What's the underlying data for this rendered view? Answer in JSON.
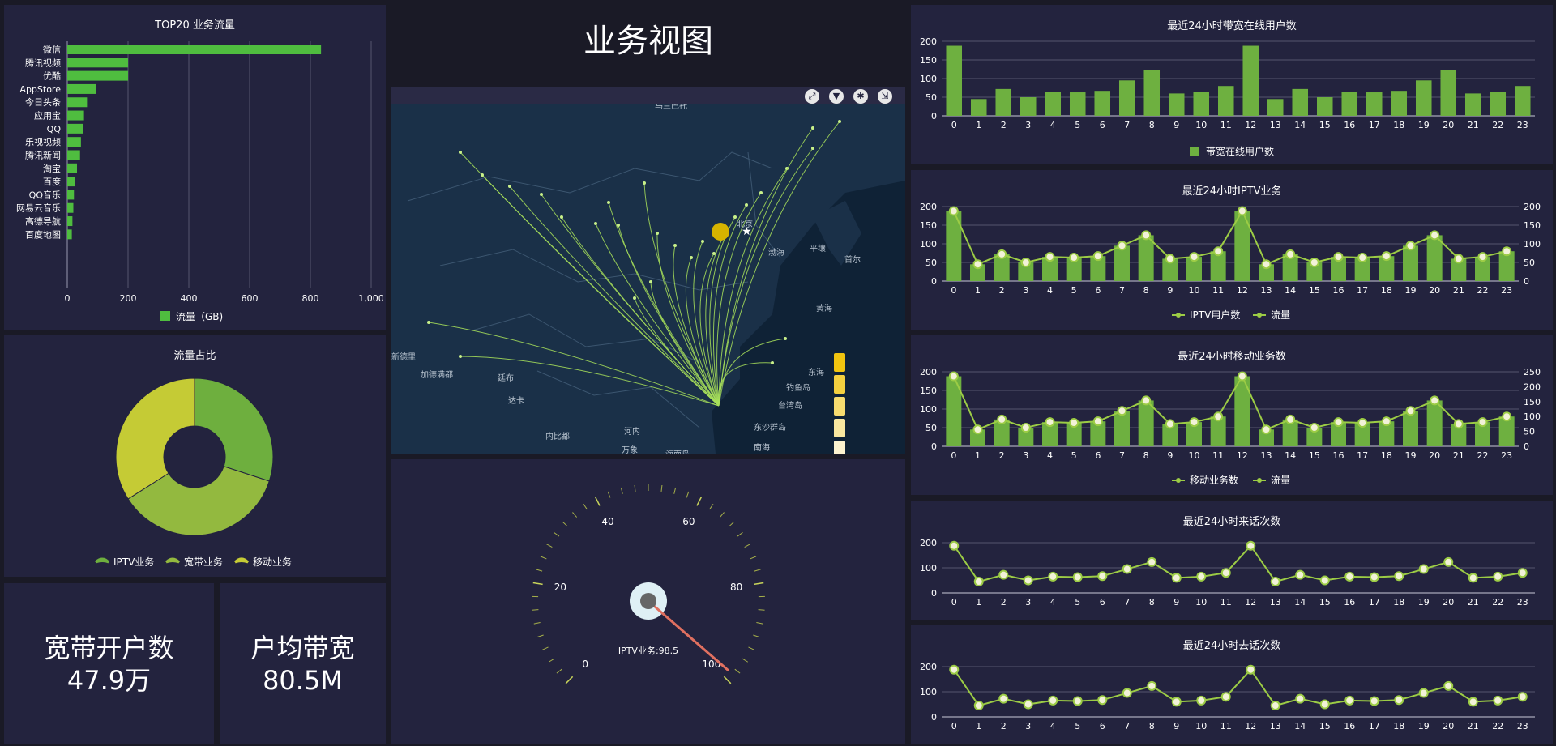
{
  "header": {
    "title": "业务视图"
  },
  "top20": {
    "title": "TOP20 业务流量",
    "legend": "流量（GB)",
    "color": "#4fbd3f",
    "categories": [
      "微信",
      "腾讯视频",
      "优酷",
      "AppStore",
      "今日头条",
      "应用宝",
      "QQ",
      "乐视视频",
      "腾讯新闻",
      "淘宝",
      "百度",
      "QQ音乐",
      "网易云音乐",
      "高德导航",
      "百度地图"
    ],
    "values": [
      835,
      200,
      200,
      95,
      65,
      55,
      52,
      45,
      42,
      32,
      25,
      22,
      20,
      17,
      15
    ],
    "xticks": [
      "0",
      "200",
      "400",
      "600",
      "800",
      "1,000"
    ]
  },
  "ratio": {
    "title": "流量占比",
    "legend": [
      "IPTV业务",
      "宽带业务",
      "移动业务"
    ],
    "values": [
      30,
      36,
      34
    ],
    "colors": [
      "#6eaf3e",
      "#93b93f",
      "#c5cb35"
    ]
  },
  "stats": [
    {
      "label": "宽带开户数",
      "value": "47.9万"
    },
    {
      "label": "户均带宽",
      "value": "80.5M"
    }
  ],
  "map": {
    "labels": [
      "乌兰巴托",
      "北京",
      "渤海",
      "平壤",
      "首尔",
      "黄海",
      "东海",
      "钓鱼岛",
      "台湾岛",
      "东沙群岛",
      "南海",
      "海南岛",
      "河内",
      "内比都",
      "万象",
      "达卡",
      "加德满都",
      "新德里",
      "廷布"
    ],
    "tools": [
      "fullscreen-icon",
      "filter-icon",
      "settings-icon",
      "export-icon"
    ]
  },
  "gauge": {
    "label": "IPTV业务:98.5",
    "value": 98.5,
    "ticks": [
      "0",
      "20",
      "40",
      "60",
      "80",
      "100"
    ]
  },
  "hours": [
    "0",
    "1",
    "2",
    "3",
    "4",
    "5",
    "6",
    "7",
    "8",
    "9",
    "10",
    "11",
    "12",
    "13",
    "14",
    "15",
    "16",
    "17",
    "18",
    "19",
    "20",
    "21",
    "22",
    "23"
  ],
  "series24": [
    188,
    45,
    72,
    50,
    65,
    63,
    67,
    95,
    123,
    60,
    65,
    80,
    188,
    45,
    72,
    50,
    65,
    63,
    67,
    95,
    123,
    60,
    65,
    80
  ],
  "charts": {
    "c1": {
      "title": "最近24小时带宽在线用户数",
      "legend": "带宽在线用户数",
      "yticks": [
        "0",
        "50",
        "100",
        "150",
        "200"
      ]
    },
    "c2": {
      "title": "最近24小时IPTV业务",
      "legend_bar": "IPTV用户数",
      "legend_line": "流量",
      "yticks": [
        "0",
        "50",
        "100",
        "150",
        "200"
      ],
      "y2ticks": [
        "0",
        "50",
        "100",
        "150",
        "200"
      ]
    },
    "c3": {
      "title": "最近24小时移动业务数",
      "legend_bar": "移动业务数",
      "legend_line": "流量",
      "yticks": [
        "0",
        "50",
        "100",
        "150",
        "200"
      ],
      "y2ticks": [
        "0",
        "50",
        "100",
        "150",
        "200",
        "250"
      ]
    },
    "c4": {
      "title": "最近24小时来话次数",
      "yticks": [
        "0",
        "100",
        "200"
      ]
    },
    "c5": {
      "title": "最近24小时去话次数",
      "yticks": [
        "0",
        "100",
        "200"
      ]
    }
  },
  "chart_data": [
    {
      "type": "bar",
      "title": "TOP20 业务流量",
      "categories": [
        "微信",
        "腾讯视频",
        "优酷",
        "AppStore",
        "今日头条",
        "应用宝",
        "QQ",
        "乐视视频",
        "腾讯新闻",
        "淘宝",
        "百度",
        "QQ音乐",
        "网易云音乐",
        "高德导航",
        "百度地图"
      ],
      "values": [
        835,
        200,
        200,
        95,
        65,
        55,
        52,
        45,
        42,
        32,
        25,
        22,
        20,
        17,
        15
      ],
      "xlim": [
        0,
        1000
      ]
    },
    {
      "type": "pie",
      "title": "流量占比",
      "categories": [
        "IPTV业务",
        "宽带业务",
        "移动业务"
      ],
      "values": [
        30,
        36,
        34
      ]
    },
    {
      "type": "bar",
      "title": "最近24小时带宽在线用户数",
      "categories": [
        "0",
        "1",
        "2",
        "3",
        "4",
        "5",
        "6",
        "7",
        "8",
        "9",
        "10",
        "11",
        "12",
        "13",
        "14",
        "15",
        "16",
        "17",
        "18",
        "19",
        "20",
        "21",
        "22",
        "23"
      ],
      "values": [
        188,
        45,
        72,
        50,
        65,
        63,
        67,
        95,
        123,
        60,
        65,
        80,
        188,
        45,
        72,
        50,
        65,
        63,
        67,
        95,
        123,
        60,
        65,
        80
      ],
      "ylim": [
        0,
        200
      ]
    },
    {
      "type": "bar",
      "title": "最近24小时IPTV业务",
      "series": [
        {
          "name": "IPTV用户数",
          "values": [
            188,
            45,
            72,
            50,
            65,
            63,
            67,
            95,
            123,
            60,
            65,
            80,
            188,
            45,
            72,
            50,
            65,
            63,
            67,
            95,
            123,
            60,
            65,
            80
          ]
        },
        {
          "name": "流量",
          "values": [
            188,
            45,
            72,
            50,
            65,
            63,
            67,
            95,
            123,
            60,
            65,
            80,
            188,
            45,
            72,
            50,
            65,
            63,
            67,
            95,
            123,
            60,
            65,
            80
          ]
        }
      ],
      "ylim": [
        0,
        200
      ]
    },
    {
      "type": "bar",
      "title": "最近24小时移动业务数",
      "series": [
        {
          "name": "移动业务数",
          "values": [
            188,
            45,
            72,
            50,
            65,
            63,
            67,
            95,
            123,
            60,
            65,
            80,
            188,
            45,
            72,
            50,
            65,
            63,
            67,
            95,
            123,
            60,
            65,
            80
          ]
        },
        {
          "name": "流量",
          "values": [
            200,
            45,
            72,
            50,
            65,
            63,
            67,
            95,
            123,
            60,
            65,
            80,
            200,
            45,
            72,
            50,
            65,
            63,
            67,
            95,
            123,
            60,
            65,
            80
          ]
        }
      ],
      "ylim": [
        0,
        200
      ]
    },
    {
      "type": "line",
      "title": "最近24小时来话次数",
      "x": [
        "0",
        "1",
        "2",
        "3",
        "4",
        "5",
        "6",
        "7",
        "8",
        "9",
        "10",
        "11",
        "12",
        "13",
        "14",
        "15",
        "16",
        "17",
        "18",
        "19",
        "20",
        "21",
        "22",
        "23"
      ],
      "values": [
        188,
        45,
        72,
        50,
        65,
        63,
        67,
        95,
        123,
        60,
        65,
        80,
        188,
        45,
        72,
        50,
        65,
        63,
        67,
        95,
        123,
        60,
        65,
        80
      ],
      "ylim": [
        0,
        200
      ]
    },
    {
      "type": "line",
      "title": "最近24小时去话次数",
      "x": [
        "0",
        "1",
        "2",
        "3",
        "4",
        "5",
        "6",
        "7",
        "8",
        "9",
        "10",
        "11",
        "12",
        "13",
        "14",
        "15",
        "16",
        "17",
        "18",
        "19",
        "20",
        "21",
        "22",
        "23"
      ],
      "values": [
        188,
        45,
        72,
        50,
        65,
        63,
        67,
        95,
        123,
        60,
        65,
        80,
        188,
        45,
        72,
        50,
        65,
        63,
        67,
        95,
        123,
        60,
        65,
        80
      ],
      "ylim": [
        0,
        200
      ]
    }
  ]
}
